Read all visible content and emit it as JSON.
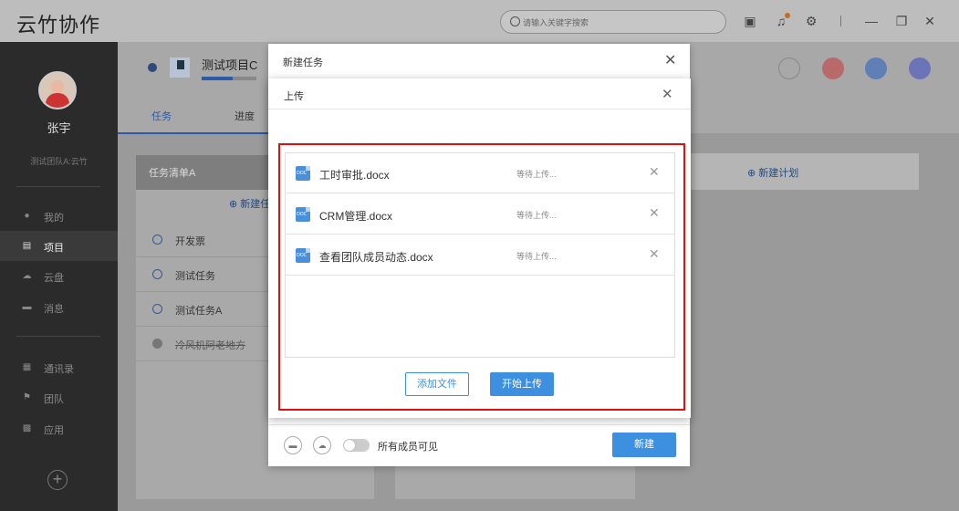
{
  "app": {
    "title": "云竹协作"
  },
  "search": {
    "placeholder": "请输入关键字搜索"
  },
  "toolbar": {
    "icons": [
      "briefcase-icon",
      "bell-icon",
      "gear-icon",
      "minimize-icon",
      "restore-icon",
      "close-icon"
    ]
  },
  "user": {
    "name": "张宇",
    "team": "测试团队A:云竹"
  },
  "sidebar": {
    "items": [
      {
        "label": "我的",
        "icon": "user-icon"
      },
      {
        "label": "项目",
        "icon": "project-icon",
        "active": true
      },
      {
        "label": "云盘",
        "icon": "cloud-icon"
      },
      {
        "label": "消息",
        "icon": "message-icon"
      },
      {
        "label": "通讯录",
        "icon": "contacts-icon"
      },
      {
        "label": "团队",
        "icon": "flag-icon"
      },
      {
        "label": "应用",
        "icon": "apps-icon"
      }
    ]
  },
  "project": {
    "name": "测试项目C",
    "tabs": [
      {
        "label": "任务",
        "active": true
      },
      {
        "label": "进度"
      }
    ],
    "header_colors": [
      "#d9534f",
      "#4a7fd4",
      "#6a7ad8"
    ]
  },
  "task_list": {
    "title": "任务清单A",
    "new_task": "⊕ 新建任",
    "tasks": [
      {
        "label": "开发票",
        "done": false
      },
      {
        "label": "测试任务",
        "done": false
      },
      {
        "label": "测试任务A",
        "done": false
      },
      {
        "label": "冷风机阿老地方",
        "done": true
      }
    ]
  },
  "plan": {
    "new_plan": "⊕ 新建计划"
  },
  "new_task_dialog": {
    "title": "新建任务",
    "visibility_label": "所有成员可见",
    "create_button": "新建"
  },
  "upload_dialog": {
    "title": "上传",
    "files": [
      {
        "name": "工时审批.docx",
        "status": "等待上传..."
      },
      {
        "name": "CRM管理.docx",
        "status": "等待上传..."
      },
      {
        "name": "查看团队成员动态.docx",
        "status": "等待上传..."
      }
    ],
    "add_button": "添加文件",
    "start_button": "开始上传"
  },
  "colors": {
    "accent": "#3d8fe0",
    "highlight_frame": "#e01010"
  }
}
